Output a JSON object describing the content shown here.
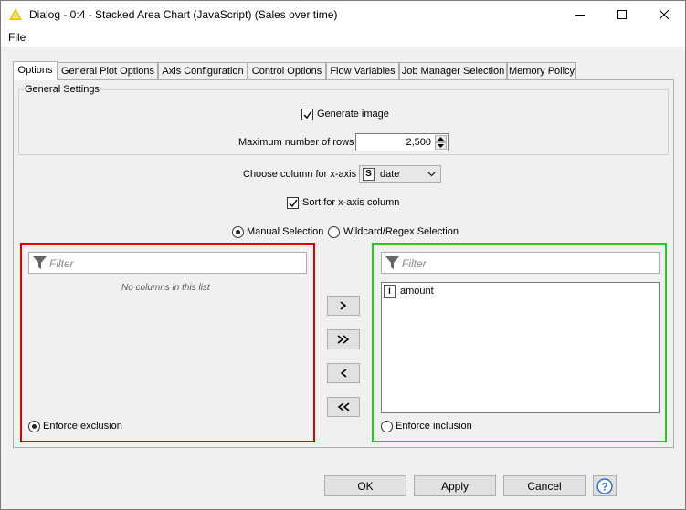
{
  "window": {
    "title": "Dialog - 0:4 - Stacked Area Chart (JavaScript) (Sales over time)",
    "menu_file": "File"
  },
  "tabs": [
    {
      "label": "Options",
      "active": true
    },
    {
      "label": "General Plot Options"
    },
    {
      "label": "Axis Configuration"
    },
    {
      "label": "Control Options"
    },
    {
      "label": "Flow Variables"
    },
    {
      "label": "Job Manager Selection"
    },
    {
      "label": "Memory Policy"
    }
  ],
  "general_settings": {
    "legend": "General Settings",
    "generate_image_label": "Generate image",
    "generate_image_checked": true,
    "max_rows_label": "Maximum number of rows",
    "max_rows_value": "2,500"
  },
  "x_axis": {
    "label": "Choose column for x-axis",
    "type_icon": "S",
    "value": "date",
    "sort_label": "Sort for x-axis column",
    "sort_checked": true
  },
  "selection_mode": {
    "manual_label": "Manual Selection",
    "wildcard_label": "Wildcard/Regex Selection",
    "selected": "manual"
  },
  "exclude": {
    "filter_placeholder": "Filter",
    "empty_message": "No columns in this list",
    "enforce_label": "Enforce exclusion",
    "enforce_selected": true,
    "border_color": "#e00000"
  },
  "include": {
    "filter_placeholder": "Filter",
    "items": [
      {
        "type_icon": "I",
        "name": "amount"
      }
    ],
    "enforce_label": "Enforce inclusion",
    "enforce_selected": false,
    "border_color": "#22cc22"
  },
  "move_buttons": [
    {
      "name": "add-button",
      "glyph": "chevron-right-icon"
    },
    {
      "name": "add-all-button",
      "glyph": "double-chevron-right-icon"
    },
    {
      "name": "remove-button",
      "glyph": "chevron-left-icon"
    },
    {
      "name": "remove-all-button",
      "glyph": "double-chevron-left-icon"
    }
  ],
  "footer": {
    "ok": "OK",
    "apply": "Apply",
    "cancel": "Cancel"
  }
}
